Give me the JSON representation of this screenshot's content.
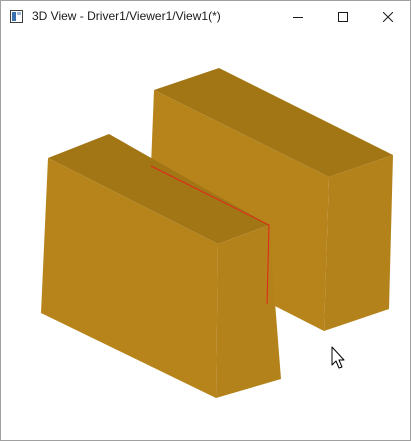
{
  "window": {
    "title": "3D View - Driver1/Viewer1/View1(*)"
  },
  "controls": {
    "minimize_icon": "minimize-icon",
    "maximize_icon": "maximize-icon",
    "close_icon": "close-icon"
  },
  "scene": {
    "object_color_top": "#a27615",
    "object_color_front": "#b6841b",
    "object_color_side": "#b4821a",
    "highlight_edge_color": "#e0241a",
    "cursor_icon": "mouse-pointer-icon"
  }
}
